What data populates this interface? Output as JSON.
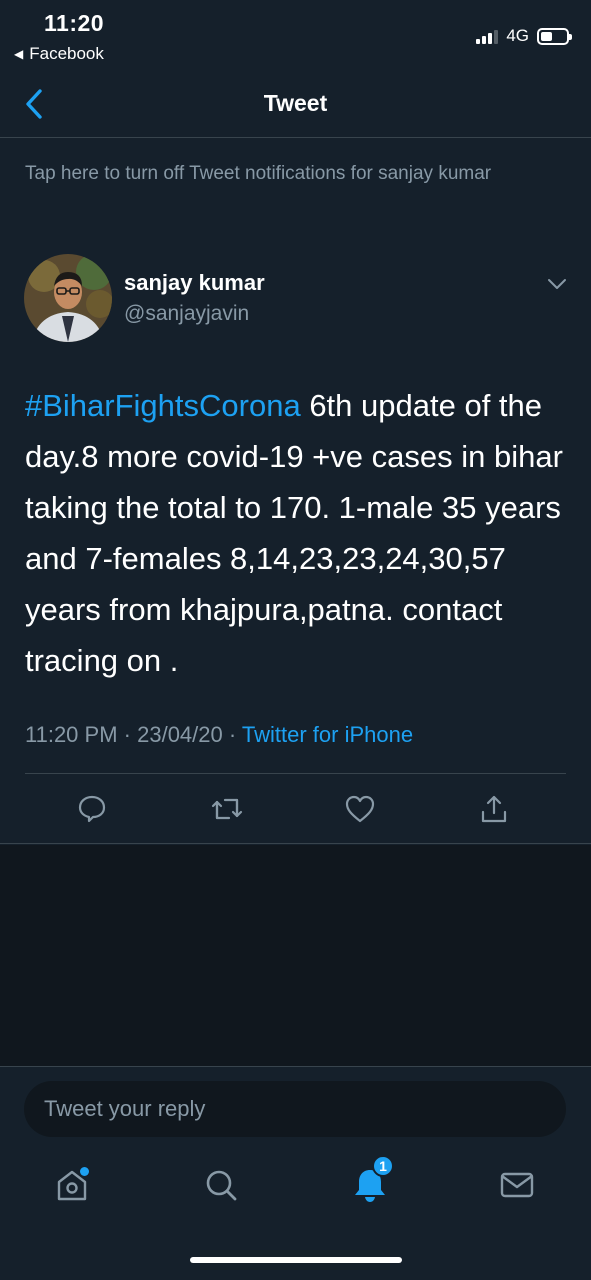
{
  "status_bar": {
    "time": "11:20",
    "back_app": "Facebook",
    "network": "4G"
  },
  "nav": {
    "title": "Tweet",
    "back_icon": "chevron-left-icon"
  },
  "notification_banner": "Tap here to turn off Tweet notifications for sanjay kumar",
  "tweet": {
    "author_name": "sanjay kumar",
    "author_handle": "@sanjayjavin",
    "hashtag": "#BiharFightsCorona",
    "body": "  6th update of the day.8 more covid-19 +ve cases in bihar taking the total to 170. 1-male 35 years and 7-females 8,14,23,23,24,30,57 years from khajpura,patna. contact tracing on .",
    "time": "11:20 PM",
    "sep1": " · ",
    "date": "23/04/20",
    "sep2": " · ",
    "source": "Twitter for iPhone"
  },
  "actions": [
    "reply-icon",
    "retweet-icon",
    "like-icon",
    "share-icon"
  ],
  "reply": {
    "placeholder": "Tweet your reply"
  },
  "tabbar": {
    "notifications_badge": "1"
  },
  "colors": {
    "background": "#15202b",
    "accent": "#1da1f2",
    "secondary_text": "#8899a6",
    "divider": "#38444d"
  }
}
